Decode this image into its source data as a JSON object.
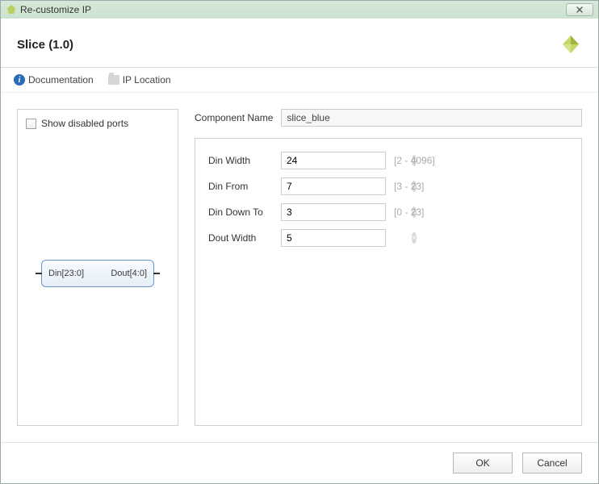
{
  "window": {
    "title": "Re-customize IP"
  },
  "header": {
    "title": "Slice (1.0)"
  },
  "toolbar": {
    "doc_label": "Documentation",
    "loc_label": "IP Location"
  },
  "left": {
    "checkbox_label": "Show disabled ports",
    "block_in": "Din[23:0]",
    "block_out": "Dout[4:0]"
  },
  "form": {
    "comp_name_label": "Component Name",
    "comp_name_value": "slice_blue",
    "params": [
      {
        "label": "Din Width",
        "value": "24",
        "hint": "[2 - 4096]"
      },
      {
        "label": "Din From",
        "value": "7",
        "hint": "[3 - 23]"
      },
      {
        "label": "Din Down To",
        "value": "3",
        "hint": "[0 - 23]"
      },
      {
        "label": "Dout Width",
        "value": "5",
        "hint": ""
      }
    ]
  },
  "footer": {
    "ok": "OK",
    "cancel": "Cancel"
  }
}
